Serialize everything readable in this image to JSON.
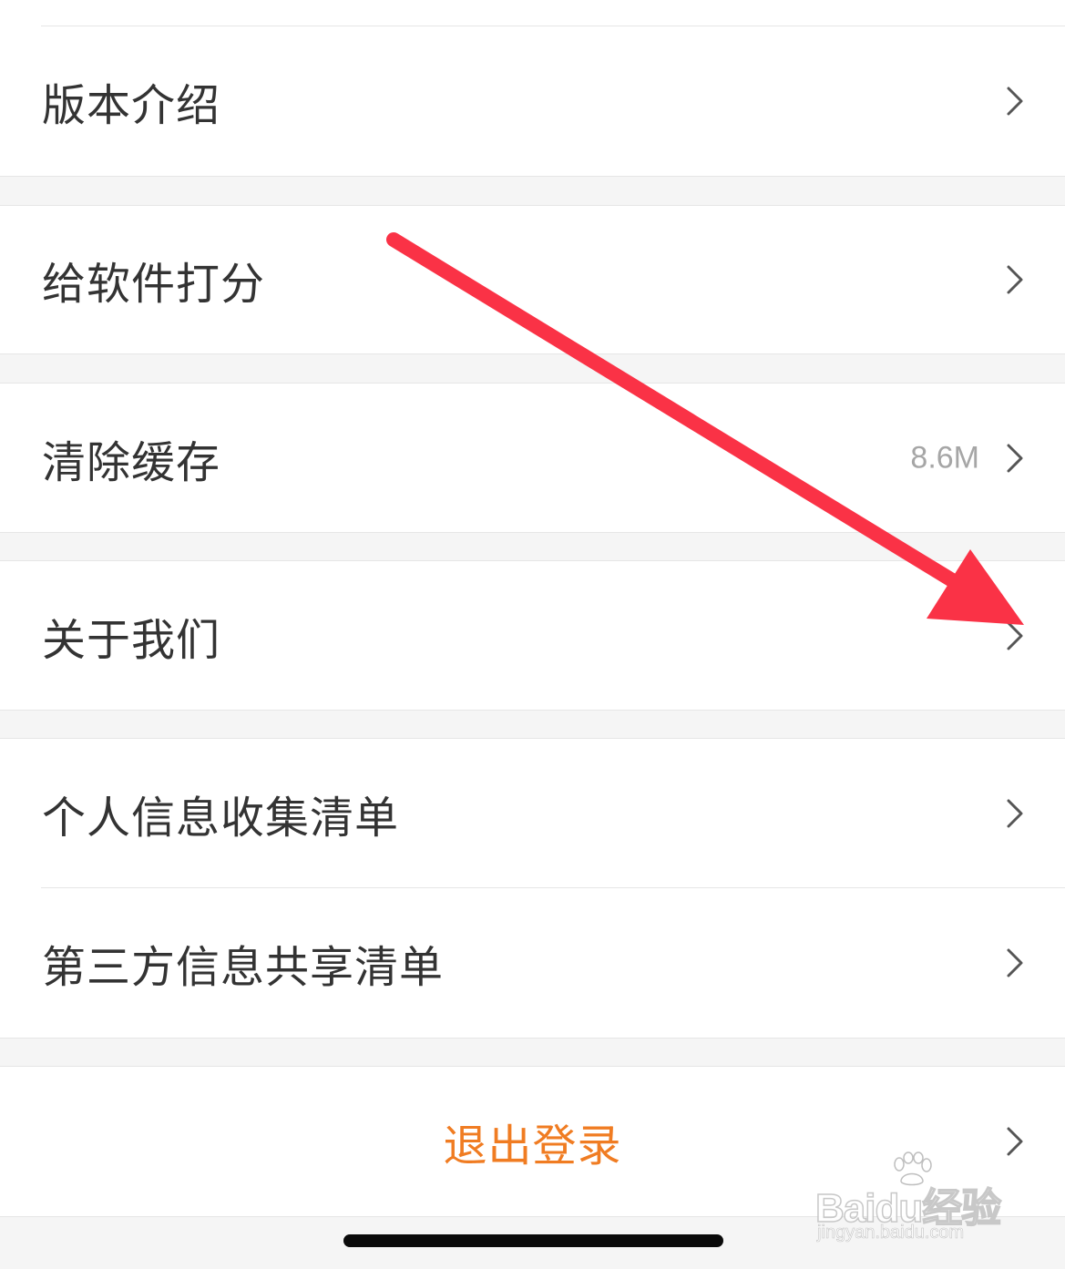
{
  "menu": {
    "items": [
      {
        "id": "version",
        "label": "版本介绍",
        "value": ""
      },
      {
        "id": "rate",
        "label": "给软件打分",
        "value": ""
      },
      {
        "id": "cache",
        "label": "清除缓存",
        "value": "8.6M"
      },
      {
        "id": "about",
        "label": "关于我们",
        "value": ""
      },
      {
        "id": "personal-info",
        "label": "个人信息收集清单",
        "value": ""
      },
      {
        "id": "third-party",
        "label": "第三方信息共享清单",
        "value": ""
      }
    ],
    "logout_label": "退出登录"
  },
  "icons": {
    "chevron": "chevron-right-icon",
    "annotation": "red-arrow-annotation"
  },
  "watermark": {
    "brand": "Baidu经验",
    "url": "jingyan.baidu.com"
  },
  "colors": {
    "background": "#f5f5f5",
    "row": "#ffffff",
    "text": "#333333",
    "secondary": "#a6a6a6",
    "logout": "#f07c22",
    "annotation_arrow": "#fa3246"
  }
}
